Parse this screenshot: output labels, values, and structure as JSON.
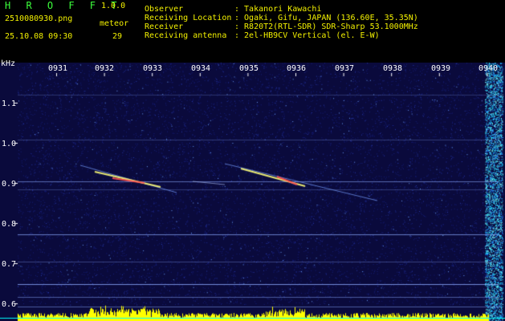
{
  "header": {
    "app_title": "H R O F F T",
    "app_version": "1.0.0",
    "file_name": "2510080930.png",
    "timestamp": "25.10.08 09:30",
    "meteor_label": "meteor",
    "meteor_count": "29",
    "info": [
      {
        "key": "Observer",
        "value": ": Takanori Kawachi"
      },
      {
        "key": "Receiving Location",
        "value": ": Ogaki, Gifu, JAPAN (136.60E, 35.35N)"
      },
      {
        "key": "Receiver",
        "value": ": R820T2(RTL-SDR) SDR-Sharp 53.1000MHz"
      },
      {
        "key": "Receiving antenna",
        "value": ": 2el-HB9CV Vertical (el. E-W)"
      }
    ]
  },
  "spectrogram": {
    "unit": "kHz",
    "freq_ticks": [
      "1.1",
      "1.0",
      "0.9",
      "0.8",
      "0.7",
      "0.6"
    ],
    "time_ticks": [
      "0931",
      "0932",
      "0933",
      "0934",
      "0935",
      "0936",
      "0937",
      "0938",
      "0939",
      "0940"
    ],
    "background": "#0a0a3c",
    "tick_color": "#ffffff",
    "signal_color": "#ffff00",
    "noise_color": "#00ffff"
  }
}
